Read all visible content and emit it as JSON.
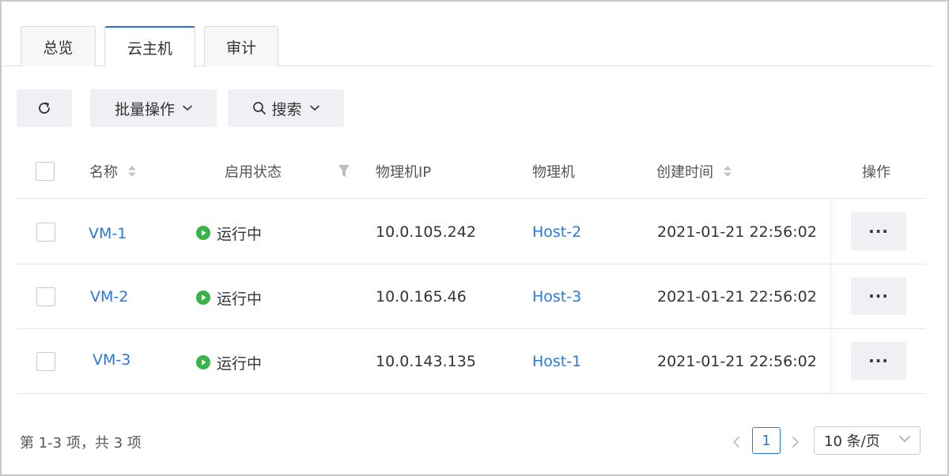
{
  "tabs": [
    {
      "label": "总览",
      "active": false
    },
    {
      "label": "云主机",
      "active": true
    },
    {
      "label": "审计",
      "active": false
    }
  ],
  "toolbar": {
    "refresh_icon": "refresh-icon",
    "batch_label": "批量操作",
    "search_label": "搜索"
  },
  "table": {
    "columns": {
      "name": "名称",
      "status": "启用状态",
      "ip": "物理机IP",
      "host": "物理机",
      "created": "创建时间",
      "actions": "操作"
    },
    "rows": [
      {
        "name": "VM-1",
        "status": "运行中",
        "ip": "10.0.105.242",
        "host": "Host-2",
        "created": "2021-01-21 22:56:02",
        "more": "···"
      },
      {
        "name": "VM-2",
        "status": "运行中",
        "ip": "10.0.165.46",
        "host": "Host-3",
        "created": "2021-01-21 22:56:02",
        "more": "···"
      },
      {
        "name": "VM-3",
        "status": "运行中",
        "ip": "10.0.143.135",
        "host": "Host-1",
        "created": "2021-01-21 22:56:02",
        "more": "···"
      }
    ]
  },
  "footer": {
    "summary": "第 1-3 项，共 3 项",
    "current_page": "1",
    "page_size": "10 条/页"
  },
  "colors": {
    "accent": "#2f6bd9",
    "link": "#2a78d6",
    "status_running": "#3bb34a"
  }
}
